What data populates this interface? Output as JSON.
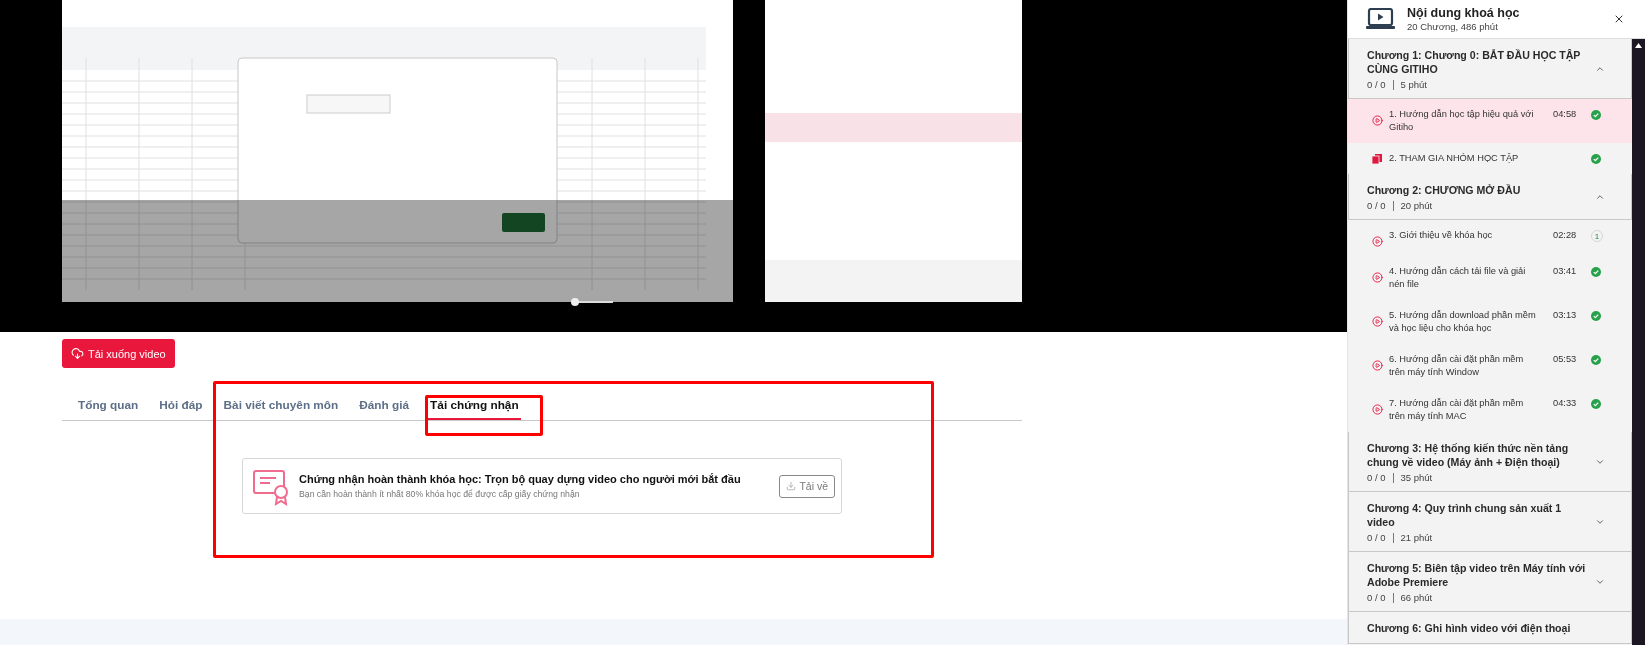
{
  "download_button": "Tải xuống video",
  "tabs": [
    {
      "label": "Tổng quan",
      "selected": false
    },
    {
      "label": "Hỏi đáp",
      "selected": false
    },
    {
      "label": "Bài viết chuyên môn",
      "selected": false
    },
    {
      "label": "Đánh giá",
      "selected": false
    },
    {
      "label": "Tải chứng nhận",
      "selected": true
    }
  ],
  "certificate": {
    "title": "Chứng nhận hoàn thành khóa học: Trọn bộ quay dựng video cho người mới bắt đầu",
    "note": "Bạn cần hoàn thành ít nhất 80% khóa học để được cấp giấy chứng nhận",
    "button": "Tải về",
    "disabled": true
  },
  "course_panel": {
    "title": "Nội dung khoá học",
    "subtitle": "20 Chương, 486 phút",
    "chapters": [
      {
        "title": "Chương 1: Chương 0: BẮT ĐẦU HỌC TẬP CÙNG GITIHO",
        "progress": "0 / 0",
        "duration": "5 phút",
        "expanded": true,
        "lessons": [
          {
            "kind": "video",
            "title": "1. Hướng dẫn học tập hiệu quả với Gitiho",
            "duration": "04:58",
            "done": true,
            "selected": true
          },
          {
            "kind": "document",
            "title": "2. THAM GIA NHÓM HỌC TẬP",
            "done": true,
            "selected": false
          }
        ]
      },
      {
        "title": "Chương 2: CHƯƠNG MỞ ĐẦU",
        "progress": "0 / 0",
        "duration": "20 phút",
        "expanded": true,
        "lessons": [
          {
            "kind": "video",
            "title": "3. Giới thiệu về khóa học",
            "duration": "02:28",
            "done": false,
            "progress": "1",
            "selected": false
          },
          {
            "kind": "video",
            "title": "4. Hướng dẫn cách tải file và giải nén file",
            "duration": "03:41",
            "done": true,
            "selected": false
          },
          {
            "kind": "video",
            "title": "5. Hướng dẫn download phần mềm và học liệu cho khóa học",
            "duration": "03:13",
            "done": true,
            "selected": false
          },
          {
            "kind": "video",
            "title": "6. Hướng dẫn cài đặt phần mềm trên máy tính Window",
            "duration": "05:53",
            "done": true,
            "selected": false
          },
          {
            "kind": "video",
            "title": "7. Hướng dẫn cài đặt phần mềm trên máy tính MAC",
            "duration": "04:33",
            "done": true,
            "selected": false
          }
        ]
      },
      {
        "title": "Chương 3: Hệ thống kiến thức nền tảng chung về video (Máy ảnh + Điện thoại)",
        "progress": "0 / 0",
        "duration": "35 phút",
        "expanded": false
      },
      {
        "title": "Chương 4: Quy trình chung sản xuất 1 video",
        "progress": "0 / 0",
        "duration": "21 phút",
        "expanded": false
      },
      {
        "title": "Chương 5: Biên tập video trên Máy tính với Adobe Premiere",
        "progress": "0 / 0",
        "duration": "66 phút",
        "expanded": false
      },
      {
        "title": "Chương 6: Ghi hình video với điện thoại"
      }
    ]
  }
}
